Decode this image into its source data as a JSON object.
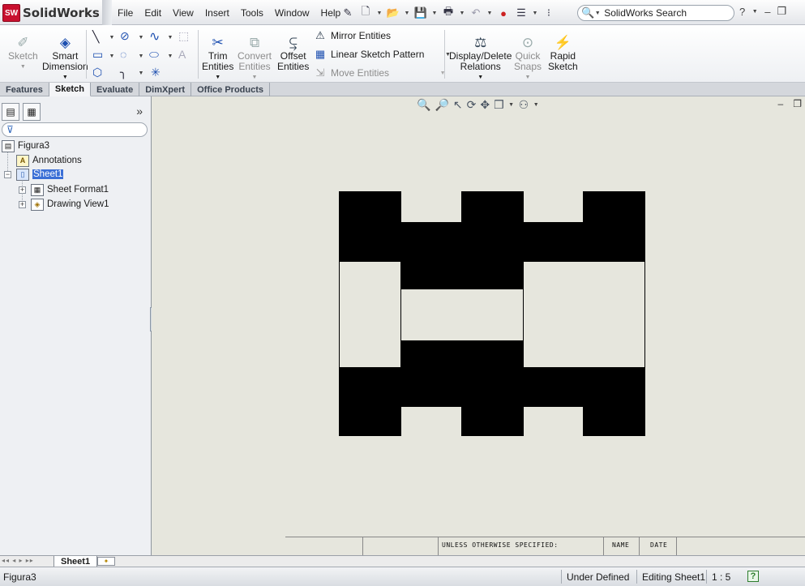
{
  "app": {
    "name": "SolidWorks",
    "badge": "SW"
  },
  "menus": [
    "File",
    "Edit",
    "View",
    "Insert",
    "Tools",
    "Window",
    "Help"
  ],
  "search": {
    "placeholder": "SolidWorks Search"
  },
  "ribbon": {
    "sketch": "Sketch",
    "smart_dimension_1": "Smart",
    "smart_dimension_2": "Dimension",
    "trim_1": "Trim",
    "trim_2": "Entities",
    "convert_1": "Convert",
    "convert_2": "Entities",
    "offset_1": "Offset",
    "offset_2": "Entities",
    "mirror": "Mirror Entities",
    "linear_pattern": "Linear Sketch Pattern",
    "move": "Move Entities",
    "display_delete_1": "Display/Delete",
    "display_delete_2": "Relations",
    "quick_snaps_1": "Quick",
    "quick_snaps_2": "Snaps",
    "rapid_sketch_1": "Rapid",
    "rapid_sketch_2": "Sketch"
  },
  "tabs": [
    "Features",
    "Sketch",
    "Evaluate",
    "DimXpert",
    "Office Products"
  ],
  "active_tab": "Sketch",
  "tree": {
    "root": "Figura3",
    "annotations": "Annotations",
    "sheet": "Sheet1",
    "sheet_format": "Sheet Format1",
    "drawing_view": "Drawing View1"
  },
  "title_block": {
    "unless": "UNLESS OTHERWISE SPECIFIED:",
    "name": "NAME",
    "date": "DATE"
  },
  "sheet_tab": "Sheet1",
  "status": {
    "document": "Figura3",
    "state": "Under Defined",
    "editing": "Editing Sheet1",
    "scale": "1 : 5",
    "help": "?"
  },
  "colors": {
    "canvas": "#e6e6dd",
    "fill": "#000000",
    "selection": "#3b6fd6"
  }
}
